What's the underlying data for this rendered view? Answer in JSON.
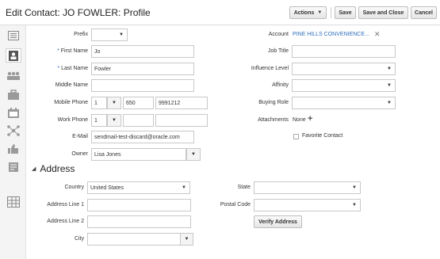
{
  "header": {
    "title": "Edit Contact: JO FOWLER: Profile",
    "actions_label": "Actions",
    "save_label": "Save",
    "save_close_label": "Save and Close",
    "cancel_label": "Cancel"
  },
  "sidebar": {
    "icons": [
      "list-icon",
      "contact-card-icon",
      "people-icon",
      "briefcase-icon",
      "calendar-icon",
      "network-icon",
      "thumbs-up-icon",
      "notes-icon",
      "table-icon"
    ]
  },
  "form": {
    "prefix": {
      "label": "Prefix",
      "value": ""
    },
    "first_name": {
      "label": "First Name",
      "value": "Jo"
    },
    "last_name": {
      "label": "Last Name",
      "value": "Fowler"
    },
    "middle_name": {
      "label": "Middle Name",
      "value": ""
    },
    "mobile_phone": {
      "label": "Mobile Phone",
      "country": "1",
      "area": "650",
      "number": "9991212"
    },
    "work_phone": {
      "label": "Work Phone",
      "country": "1",
      "area": "",
      "number": ""
    },
    "email": {
      "label": "E-Mail",
      "value": "sendmail-test-discard@oracle.com"
    },
    "owner": {
      "label": "Owner",
      "value": "Lisa Jones"
    },
    "account": {
      "label": "Account",
      "value": "PINE HILLS CONVENIENCE..."
    },
    "job_title": {
      "label": "Job Title",
      "value": ""
    },
    "influence_level": {
      "label": "Influence Level",
      "value": ""
    },
    "affinity": {
      "label": "Affinity",
      "value": ""
    },
    "buying_role": {
      "label": "Buying Role",
      "value": ""
    },
    "attachments": {
      "label": "Attachments",
      "value": "None"
    },
    "favorite_contact": {
      "label": "Favorite Contact",
      "checked": false
    }
  },
  "address": {
    "section_title": "Address",
    "country": {
      "label": "Country",
      "value": "United States"
    },
    "address_line_1": {
      "label": "Address Line 1",
      "value": ""
    },
    "address_line_2": {
      "label": "Address Line 2",
      "value": ""
    },
    "city": {
      "label": "City",
      "value": ""
    },
    "state": {
      "label": "State",
      "value": ""
    },
    "postal_code": {
      "label": "Postal Code",
      "value": ""
    },
    "verify_label": "Verify Address"
  }
}
